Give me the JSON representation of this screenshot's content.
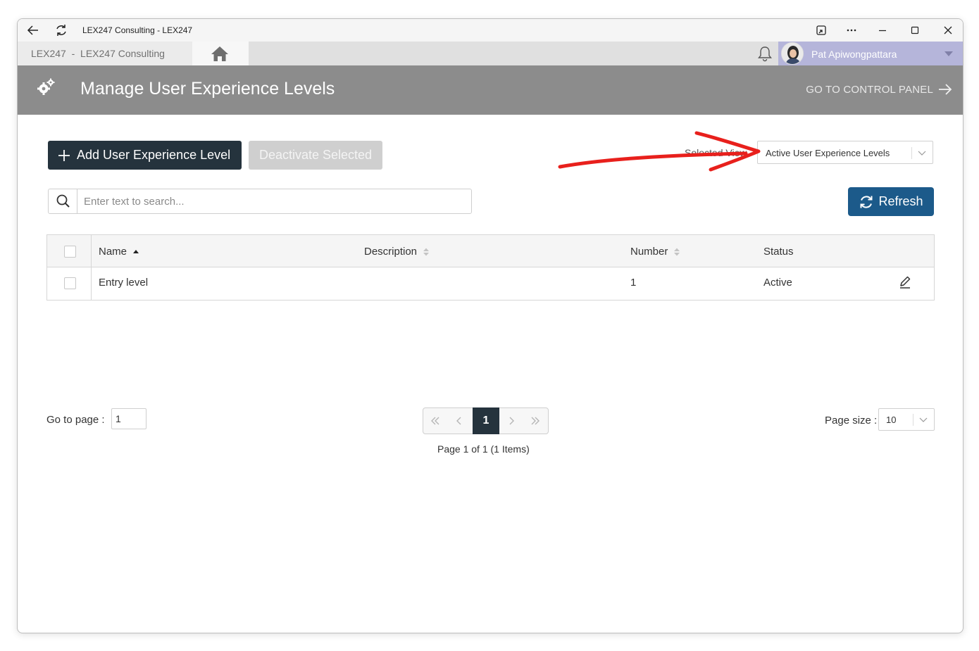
{
  "browser": {
    "title": "LEX247 Consulting - LEX247"
  },
  "appbar": {
    "breadcrumb": "LEX247  -  LEX247 Consulting",
    "user_name": "Pat Apiwongpattara"
  },
  "header": {
    "title": "Manage User Experience Levels",
    "control_panel_link": "GO TO CONTROL PANEL"
  },
  "toolbar": {
    "add_label": "Add User Experience Level",
    "deactivate_label": "Deactivate Selected",
    "view_label": "Selected View",
    "view_value": "Active User Experience Levels",
    "refresh_label": "Refresh"
  },
  "search": {
    "placeholder": "Enter text to search..."
  },
  "table": {
    "columns": [
      "Name",
      "Description",
      "Number",
      "Status"
    ],
    "rows": [
      {
        "name": "Entry level",
        "description": "",
        "number": "1",
        "status": "Active"
      }
    ]
  },
  "pager": {
    "goto_label": "Go to page :",
    "goto_value": "1",
    "current_page": "1",
    "info": "Page 1 of 1 (1 Items)",
    "page_size_label": "Page size :",
    "page_size_value": "10"
  },
  "colors": {
    "header_bg": "#8c8c8c",
    "primary_dark": "#25333d",
    "refresh_blue": "#1c5a8a",
    "user_bar": "#b5b5da",
    "annotation_arrow": "#e8201c"
  }
}
